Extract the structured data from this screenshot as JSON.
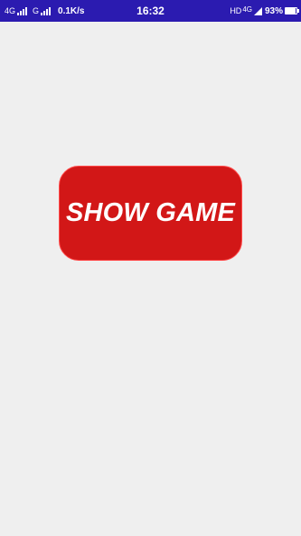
{
  "status_bar": {
    "network_left_1": "4G",
    "network_left_2": "G",
    "data_speed": "0.1K/s",
    "time": "16:32",
    "hd_label": "HD",
    "network_right": "4G",
    "battery_percent": "93%",
    "battery_level": 0.93,
    "icons": [
      "signal-bars-icon",
      "signal-bars-icon",
      "hd-voice-icon",
      "signal-triangle-icon",
      "battery-icon"
    ],
    "background_color": "#2b1bb0"
  },
  "main": {
    "background_color": "#efefef",
    "show_game_button": {
      "label": "SHOW GAME",
      "color": "#d21717"
    }
  }
}
